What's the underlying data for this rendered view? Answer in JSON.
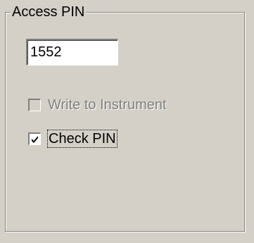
{
  "group": {
    "title": "Access PIN"
  },
  "pin_field": {
    "value": "1552"
  },
  "write_to_instrument": {
    "label": "Write to Instrument",
    "checked": false,
    "enabled": false
  },
  "check_pin": {
    "label": "Check PIN",
    "checked": true,
    "enabled": true
  },
  "colors": {
    "face": "#d4d0c8",
    "shadow": "#808080",
    "highlight": "#ffffff",
    "disabled_text": "#808080"
  }
}
